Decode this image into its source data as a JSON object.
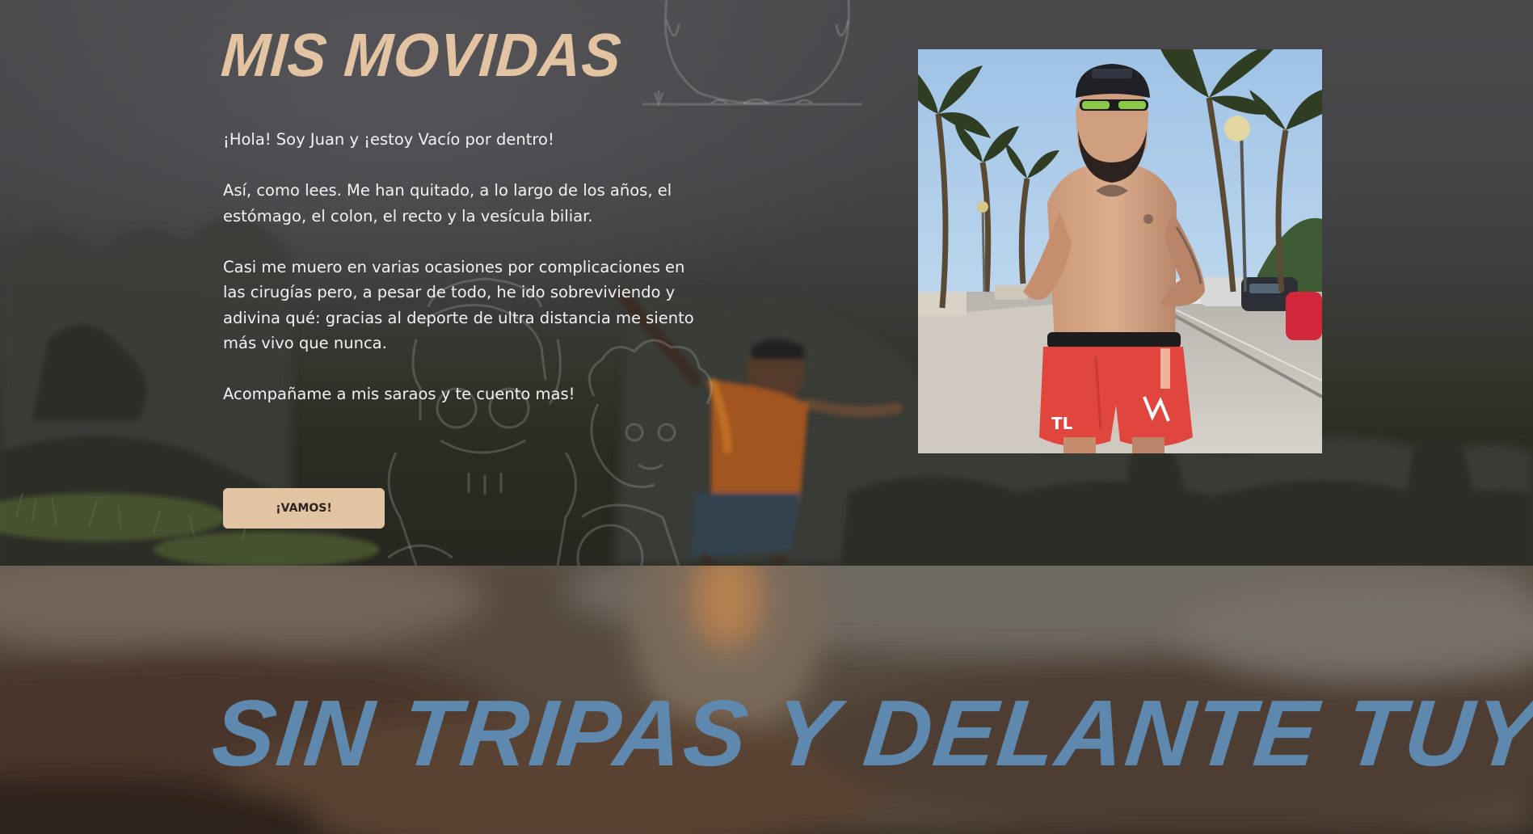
{
  "about": {
    "title": "MIS MOVIDAS",
    "paragraphs": [
      "¡Hola! Soy Juan y ¡estoy Vacío por dentro!",
      "Así, como lees. Me han quitado, a lo largo de los años, el estómago, el colon, el recto y la vesícula biliar.",
      "Casi me muero en varias ocasiones por complicaciones en las cirugías pero, a pesar de todo, he ido sobreviviendo y adivina qué: gracias al deporte de ultra distancia me siento más vivo que nunca.",
      "Acompañame a mis saraos y te cuento mas!"
    ],
    "cta_label": "¡VAMOS!"
  },
  "banner": {
    "tagline": "SIN TRIPAS Y DELANTE TUYO"
  },
  "colors": {
    "accent": "#e2c3a2",
    "tagline": "#5e88ad",
    "background": "#3b3b3e"
  }
}
